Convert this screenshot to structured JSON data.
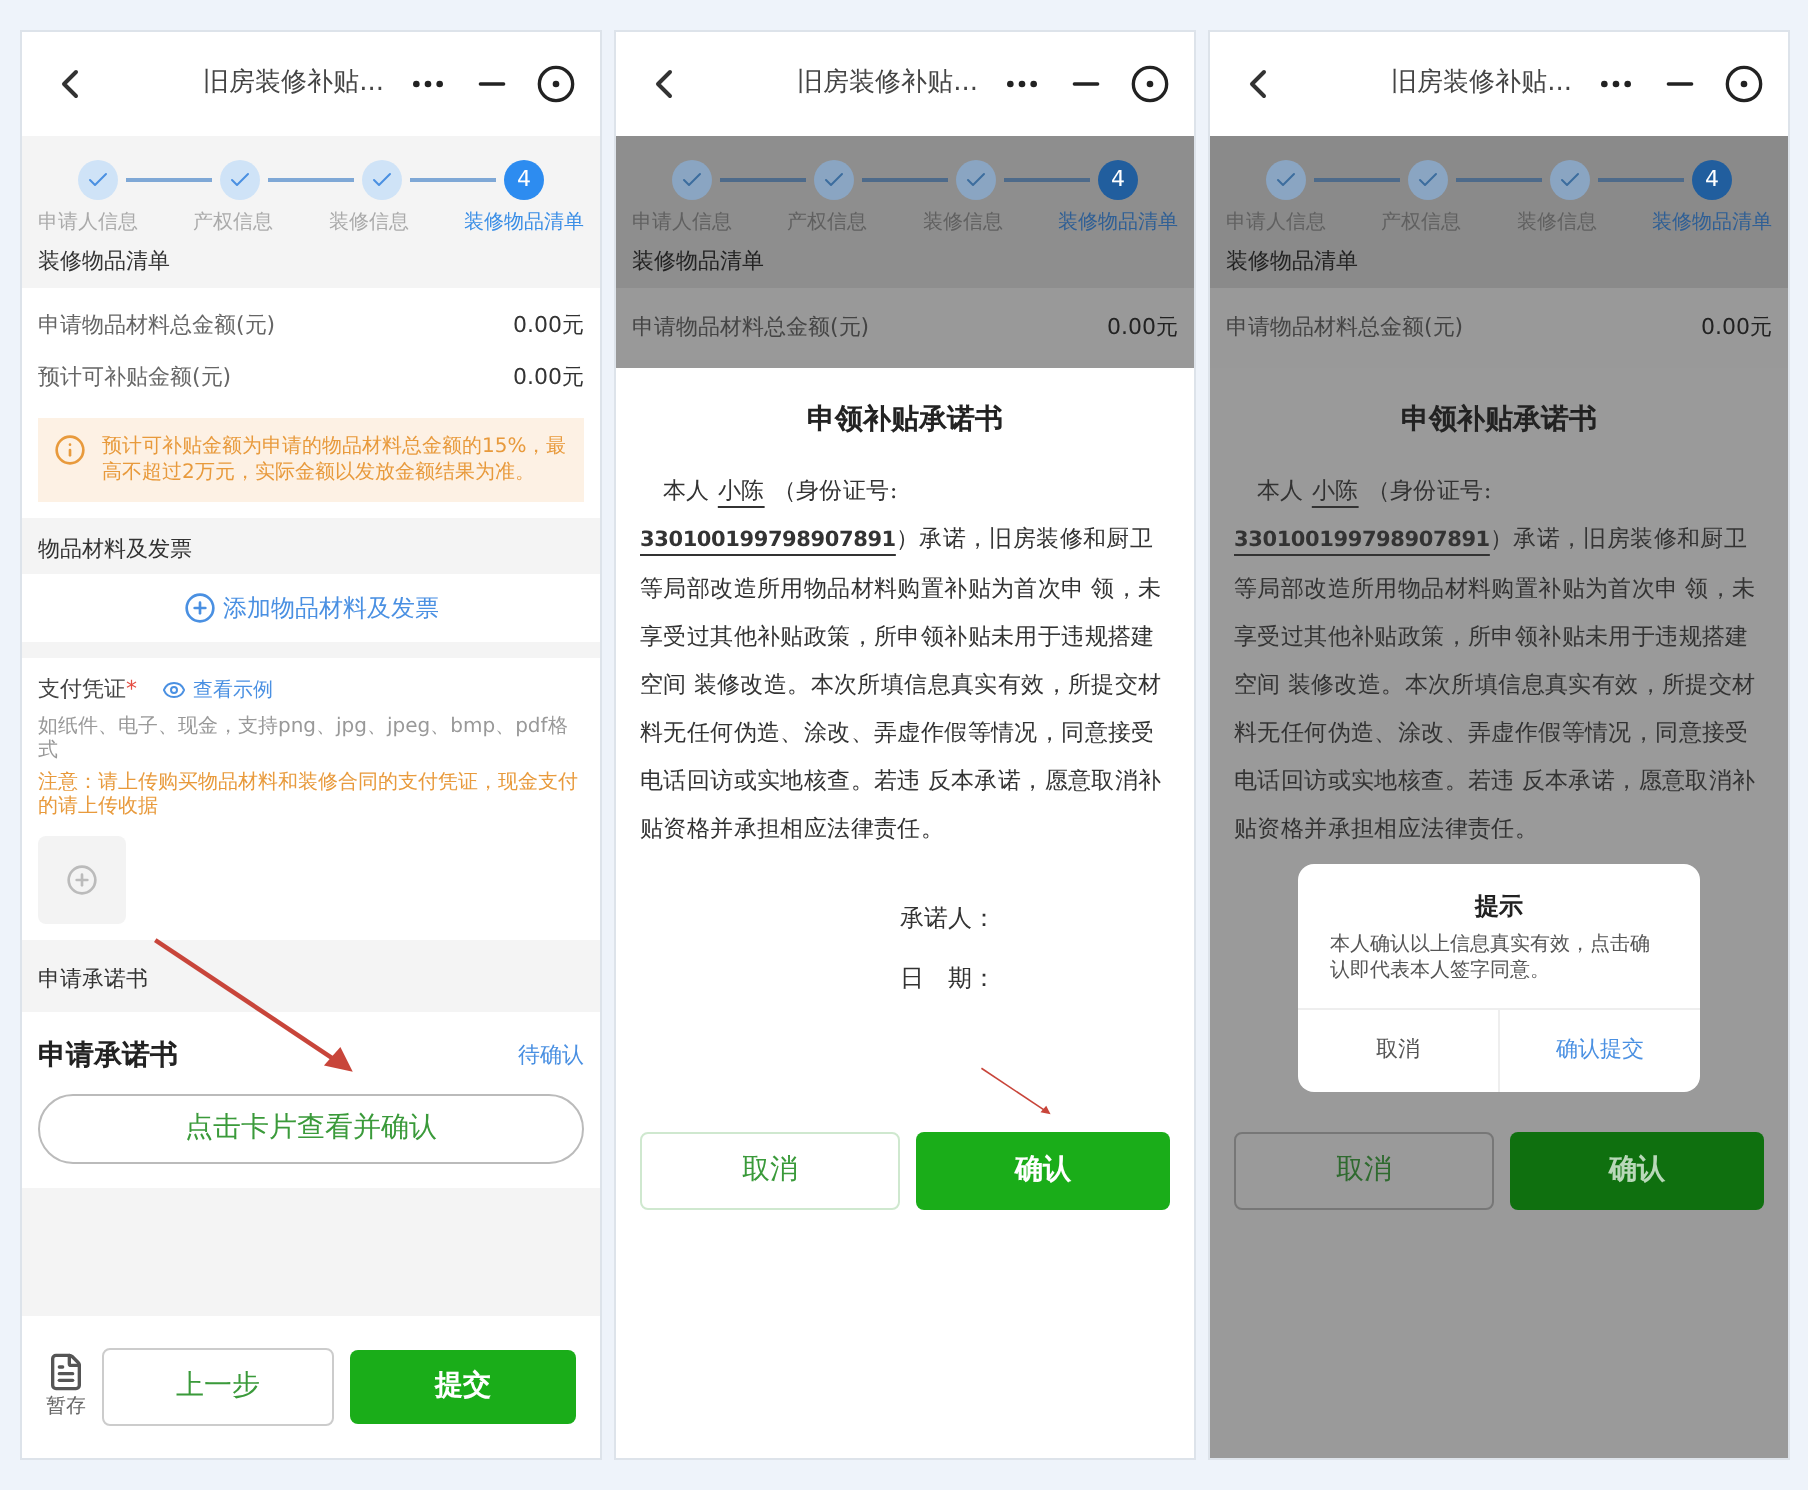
{
  "screens": [
    {
      "kind": "form",
      "arrow": true,
      "title": "旧房装修补贴...",
      "steps": [
        {
          "label": "申请人信息",
          "done": true,
          "selected": false
        },
        {
          "label": "产权信息",
          "done": true,
          "selected": false
        },
        {
          "label": "装修信息",
          "done": true,
          "selected": false
        },
        {
          "label": "装修物品清单",
          "done": false,
          "number": "4",
          "selected": true
        }
      ],
      "section_title": "装修物品清单",
      "amounts": [
        {
          "label": "申请物品材料总金额(元)",
          "value": "0.00元"
        },
        {
          "label": "预计可补贴金额(元)",
          "value": "0.00元"
        }
      ],
      "notice": "预计可补贴金额为申请的物品材料总金额的15%，最高不超过2万元，实际金额以发放金额结果为准。",
      "materials": {
        "title": "物品材料及发票",
        "add_label": "添加物品材料及发票"
      },
      "payment": {
        "label": "支付凭证",
        "required": "*",
        "example_link": "查看示例",
        "hint": "如纸件、电子、现金，支持png、jpg、jpeg、bmp、pdf格式",
        "warning": "注意：请上传购买物品材料和装修合同的支付凭证，现金支付的请上传收据"
      },
      "pledge": {
        "section_title": "申请承诺书",
        "title": "申请承诺书",
        "status": "待确认",
        "button": "点击卡片查看并确认"
      },
      "footer": {
        "save": "暂存",
        "prev": "上一步",
        "submit": "提交"
      }
    },
    {
      "kind": "sheet",
      "arrow": true,
      "title": "旧房装修补贴...",
      "steps": [
        {
          "label": "申请人信息",
          "done": true,
          "selected": false
        },
        {
          "label": "产权信息",
          "done": true,
          "selected": false
        },
        {
          "label": "装修信息",
          "done": true,
          "selected": false
        },
        {
          "label": "装修物品清单",
          "done": false,
          "number": "4",
          "selected": true
        }
      ],
      "section_title": "装修物品清单",
      "amounts": [
        {
          "label": "申请物品材料总金额(元)",
          "value": "0.00元"
        }
      ],
      "letter": {
        "title": "申领补贴承诺书",
        "intro": "本人",
        "name": "小陈",
        "id_label": "（身份证号: ",
        "id": "330100199798907891",
        "id_end": "）",
        "body": "承诺，旧房装修和厨卫等局部改造所用物品材料购置补贴为首次申 领，未享受过其他补贴政策，所申领补贴未用于违规搭建空间 装修改造。本次所填信息真实有效，所提交材料无任何伪造、涂改、弄虚作假等情况，同意接受电话回访或实地核查。若违 反本承诺，愿意取消补贴资格并承担相应法律责任。",
        "signer": "承诺人：",
        "date": "日　期：",
        "cancel": "取消",
        "confirm": "确认"
      }
    },
    {
      "kind": "sheet",
      "arrow": false,
      "title": "旧房装修补贴...",
      "steps": [
        {
          "label": "申请人信息",
          "done": true,
          "selected": false
        },
        {
          "label": "产权信息",
          "done": true,
          "selected": false
        },
        {
          "label": "装修信息",
          "done": true,
          "selected": false
        },
        {
          "label": "装修物品清单",
          "done": false,
          "number": "4",
          "selected": true
        }
      ],
      "section_title": "装修物品清单",
      "amounts": [
        {
          "label": "申请物品材料总金额(元)",
          "value": "0.00元"
        }
      ],
      "letter": {
        "title": "申领补贴承诺书",
        "intro": "本人",
        "name": "小陈",
        "id_label": "（身份证号: ",
        "id": "330100199798907891",
        "id_end": "）",
        "body": "承诺，旧房装修和厨卫等局部改造所用物品材料购置补贴为首次申 领，未享受过其他补贴政策，所申领补贴未用于违规搭建空间 装修改造。本次所填信息真实有效，所提交材料无任何伪造、涂改、弄虚作假等情况，同意接受电话回访或实地核查。若违 反本承诺，愿意取消补贴资格并承担相应法律责任。",
        "cancel": "取消",
        "confirm": "确认"
      },
      "dialog": {
        "title": "提示",
        "message": "本人确认以上信息真实有效，点击确认即代表本人签字同意。",
        "cancel": "取消",
        "confirm": "确认提交"
      }
    }
  ]
}
